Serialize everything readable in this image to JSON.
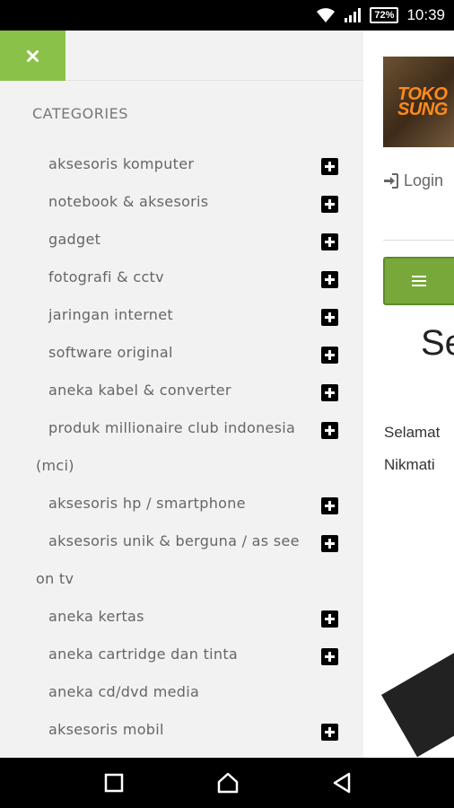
{
  "status_bar": {
    "battery": "72%",
    "time": "10:39",
    "icons": [
      "wifi-icon",
      "signal-icon",
      "battery-icon"
    ]
  },
  "drawer": {
    "close_icon": "close-icon",
    "heading": "CATEGORIES",
    "categories": [
      {
        "label": "aksesoris komputer",
        "has_sub": true
      },
      {
        "label": "notebook & aksesoris",
        "has_sub": true
      },
      {
        "label": "gadget",
        "has_sub": true
      },
      {
        "label": "fotografi & cctv",
        "has_sub": true
      },
      {
        "label": "jaringan internet",
        "has_sub": true
      },
      {
        "label": "software original",
        "has_sub": true
      },
      {
        "label": "aneka kabel & converter",
        "has_sub": true
      },
      {
        "label": "produk millionaire club indonesia",
        "label_cont": "(mci)",
        "has_sub": true
      },
      {
        "label": "aksesoris hp / smartphone",
        "has_sub": true
      },
      {
        "label": "aksesoris unik & berguna / as see",
        "label_cont": "on tv",
        "has_sub": true
      },
      {
        "label": "aneka kertas",
        "has_sub": true
      },
      {
        "label": "aneka cartridge dan tinta",
        "has_sub": true
      },
      {
        "label": "aneka cd/dvd media",
        "has_sub": false
      },
      {
        "label": "aksesoris mobil",
        "has_sub": true
      }
    ]
  },
  "page": {
    "logo_text": "TOKO SUNG",
    "login_label": "Login",
    "menu_icon": "hamburger-icon",
    "heading": "Se",
    "text_line_1": "Selamat",
    "text_line_2": "Nikmati"
  },
  "nav_bar": {
    "buttons": [
      "recent-apps-icon",
      "home-icon",
      "back-icon"
    ]
  },
  "colors": {
    "accent_green": "#8ac149",
    "menu_green": "#78a83a",
    "drawer_bg": "#f2f2f2"
  }
}
